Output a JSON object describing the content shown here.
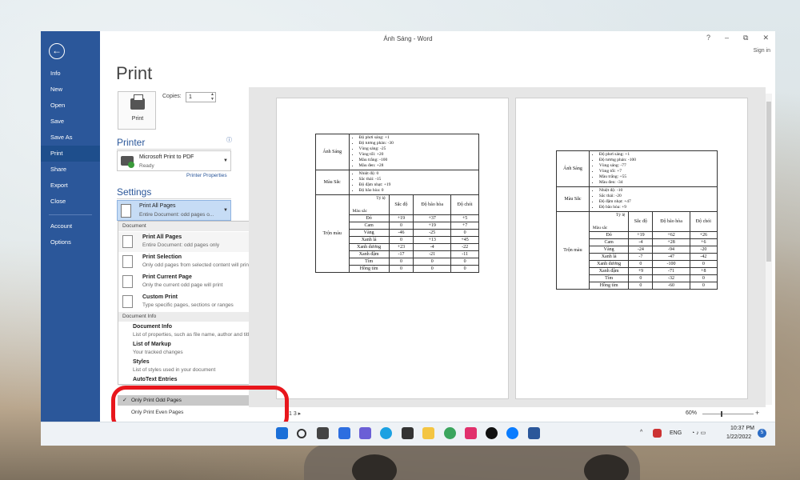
{
  "window": {
    "title": "Ánh Sáng - Word",
    "help": "?",
    "minimize": "–",
    "restore": "⧉",
    "close": "✕",
    "signin": "Sign in"
  },
  "nav": {
    "back_icon": "arrow-left-icon",
    "items": [
      "Info",
      "New",
      "Open",
      "Save",
      "Save As",
      "Print",
      "Share",
      "Export",
      "Close",
      "Account",
      "Options"
    ],
    "active": "Print"
  },
  "print": {
    "title": "Print",
    "button_label": "Print",
    "copies_label": "Copies:",
    "copies_value": "1"
  },
  "printer": {
    "section": "Printer",
    "info_icon": "ⓘ",
    "name": "Microsoft Print to PDF",
    "status": "Ready",
    "properties_link": "Printer Properties"
  },
  "settings": {
    "section": "Settings",
    "selected_main": "Print All Pages",
    "selected_sub": "Entire Document: odd pages o..."
  },
  "dropdown": {
    "document_header": "Document",
    "items": [
      {
        "title": "Print All Pages",
        "sub": "Entire Document: odd pages only"
      },
      {
        "title": "Print Selection",
        "sub": "Only odd pages from selected content will print"
      },
      {
        "title": "Print Current Page",
        "sub": "Only the current odd page will print"
      },
      {
        "title": "Custom Print",
        "sub": "Type specific pages, sections or ranges"
      }
    ],
    "docinfo_header": "Document Info",
    "doc_items": [
      {
        "title": "Document Info",
        "sub": "List of properties, such as file name, author and title"
      },
      {
        "title": "List of Markup",
        "sub": "Your tracked changes"
      },
      {
        "title": "Styles",
        "sub": "List of styles used in your document"
      },
      {
        "title": "AutoText Entries",
        "sub": ""
      }
    ],
    "odd_pages": "Only Print Odd Pages",
    "even_pages": "Only Print Even Pages",
    "check": "✓"
  },
  "preview": {
    "page_nav": "1 3 ▸",
    "zoom": "60%"
  },
  "page1": {
    "rows": [
      {
        "label": "Ánh Sáng",
        "items": [
          "Độ phơi sáng: +1",
          "Độ tương phản: -30",
          "Vùng sáng: -25",
          "Vùng tối: +20",
          "Màu trắng: -100",
          "Màu đen: +28"
        ]
      },
      {
        "label": "Màu Sắc",
        "items": [
          "Nhiệt độ: 0",
          "Sắc thái: -15",
          "Độ đậm nhạt: +19",
          "Độ bão hòa: 0"
        ]
      }
    ],
    "mix_label": "Trộn màu",
    "corner_top": "Tỷ lệ",
    "corner_bottom": "Màu sắc",
    "headers": [
      "Sắc độ",
      "Độ bão hòa",
      "Độ chói"
    ],
    "table": [
      [
        "Đỏ",
        "+19",
        "+37",
        "+5"
      ],
      [
        "Cam",
        "0",
        "+19",
        "+7"
      ],
      [
        "Vàng",
        "-46",
        "-25",
        "0"
      ],
      [
        "Xanh lá",
        "0",
        "+13",
        "+45"
      ],
      [
        "Xanh dương",
        "+23",
        "-4",
        "-22"
      ],
      [
        "Xanh đậm",
        "-17",
        "-21",
        "-11"
      ],
      [
        "Tím",
        "0",
        "0",
        "0"
      ],
      [
        "Hồng tím",
        "0",
        "0",
        "0"
      ]
    ]
  },
  "page2": {
    "rows": [
      {
        "label": "Ánh Sáng",
        "items": [
          "Độ phơi sáng: +1",
          "Độ tương phản: -100",
          "Vùng sáng: -77",
          "Vùng tối: +7",
          "Màu trắng: +55",
          "Màu đen: -34"
        ]
      },
      {
        "label": "Màu Sắc",
        "items": [
          "Nhiệt độ: -10",
          "Sắc thái: -20",
          "Độ đậm nhạt: +47",
          "Độ bão hòa: +9"
        ]
      }
    ],
    "mix_label": "Trộn màu",
    "corner_top": "Tỷ lệ",
    "corner_bottom": "Màu sắc",
    "headers": [
      "Sắc độ",
      "Độ bão hòa",
      "Độ chói"
    ],
    "table": [
      [
        "Đỏ",
        "+19",
        "+62",
        "+26"
      ],
      [
        "Cam",
        "-4",
        "+28",
        "+6"
      ],
      [
        "Vàng",
        "-24",
        "-94",
        "-20"
      ],
      [
        "Xanh lá",
        "-7",
        "-47",
        "-42"
      ],
      [
        "Xanh dương",
        "0",
        "-100",
        "0"
      ],
      [
        "Xanh đậm",
        "+9",
        "-71",
        "+8"
      ],
      [
        "Tím",
        "0",
        "-32",
        "0"
      ],
      [
        "Hồng tím",
        "0",
        "-60",
        "0"
      ]
    ]
  },
  "taskbar": {
    "lang": "ENG",
    "time": "10:37 PM",
    "date": "1/22/2022",
    "notif_count": "5",
    "chevron": "^"
  },
  "colors": {
    "accent": "#2b579a",
    "highlight_ring": "#e8161c"
  }
}
